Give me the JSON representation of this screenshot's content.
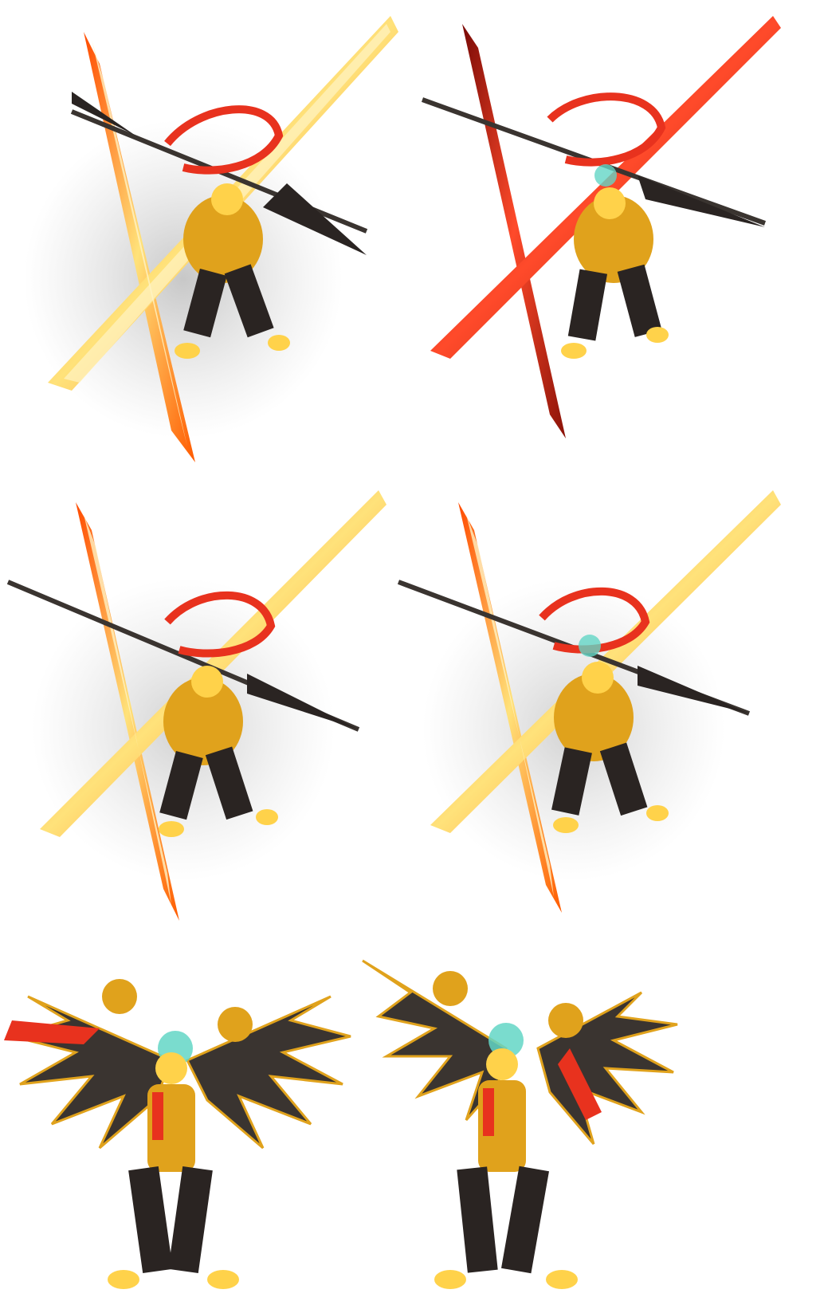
{
  "sheet": {
    "background": "#ffffff",
    "frames": [
      {
        "pose": "x-slash-bright",
        "glow": "#ffd65a",
        "slash": "#ff6a00"
      },
      {
        "pose": "x-slash-dark",
        "glow": "#ff4a2a",
        "slash": "#c0180c"
      },
      {
        "pose": "x-slash-bright",
        "glow": "#ffd65a",
        "slash": "#ff6a00"
      },
      {
        "pose": "x-slash-bright",
        "glow": "#ffd65a",
        "slash": "#ff6a00"
      },
      {
        "pose": "winged-idle"
      },
      {
        "pose": "winged-idle"
      }
    ],
    "colors": {
      "ribbon": "#e8321e",
      "gold": "#e0a21c",
      "gold_bright": "#ffd24a",
      "dark_armor": "#2a2422",
      "blade": "#3a3430",
      "orb": "#63d6c6",
      "halo": "#cfcfcf"
    }
  }
}
